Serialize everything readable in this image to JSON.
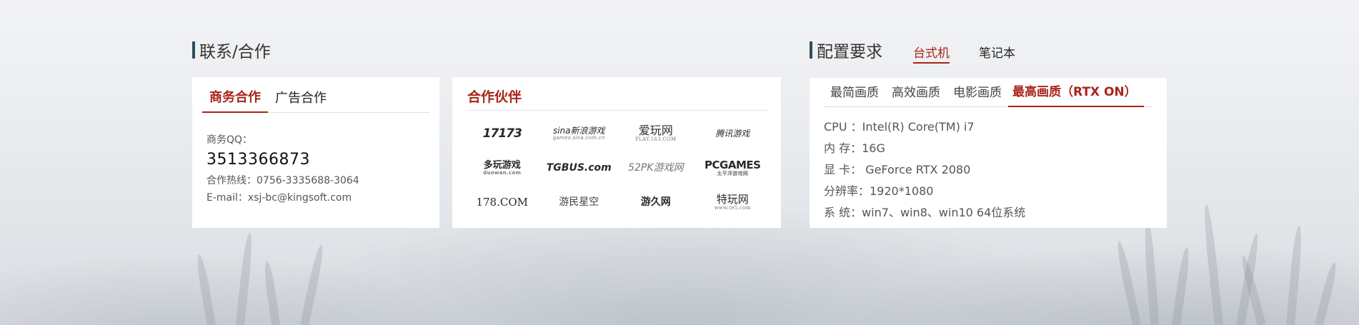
{
  "contact": {
    "title": "联系/合作",
    "tabs": [
      {
        "label": "商务合作",
        "active": true
      },
      {
        "label": "广告合作",
        "active": false
      }
    ],
    "qq_label": "商务QQ：",
    "qq": "3513366873",
    "hotline": "合作热线：0756-3335688-3064",
    "email": "E-mail：xsj-bc@kingsoft.com"
  },
  "partners": {
    "title": "合作伙伴",
    "logos": [
      {
        "name": "17173-logo",
        "text": "17173"
      },
      {
        "name": "sina-games-logo",
        "text": "sina新浪游戏",
        "sub": "games.sina.com.cn"
      },
      {
        "name": "play-163-logo",
        "text": "爱玩网",
        "sub": "PLAY.163.COM"
      },
      {
        "name": "tencent-games-logo",
        "text": "腾讯游戏"
      },
      {
        "name": "duowan-logo",
        "text": "多玩游戏",
        "sub": "duowan.com"
      },
      {
        "name": "tgbus-logo",
        "text": "TGBUS.com"
      },
      {
        "name": "52pk-logo",
        "text": "52PK游戏网"
      },
      {
        "name": "pcgames-logo",
        "text": "PCGAMES",
        "sub": "太平洋游戏网"
      },
      {
        "name": "178-logo",
        "text": "178.COM"
      },
      {
        "name": "gamersky-logo",
        "text": "游民星空"
      },
      {
        "name": "youjiu-logo",
        "text": "游久网"
      },
      {
        "name": "te5-logo",
        "text": "特玩网",
        "sub": "www.te5.com"
      }
    ]
  },
  "config": {
    "title": "配置要求",
    "device_tabs": [
      {
        "label": "台式机",
        "active": true
      },
      {
        "label": "笔记本",
        "active": false
      }
    ],
    "quality_tabs": [
      {
        "label": "最简画质",
        "active": false
      },
      {
        "label": "高效画质",
        "active": false
      },
      {
        "label": "电影画质",
        "active": false
      },
      {
        "label": "最高画质（RTX ON）",
        "active": true
      }
    ],
    "specs": [
      "CPU ：Intel(R) Core(TM) i7",
      "内 存：16G",
      "显 卡： GeForce RTX 2080",
      "分辨率：1920*1080",
      "系 统：win7、win8、win10 64位系统"
    ]
  },
  "colors": {
    "accent": "#a8251b",
    "title_bar": "#2f4f5f"
  }
}
